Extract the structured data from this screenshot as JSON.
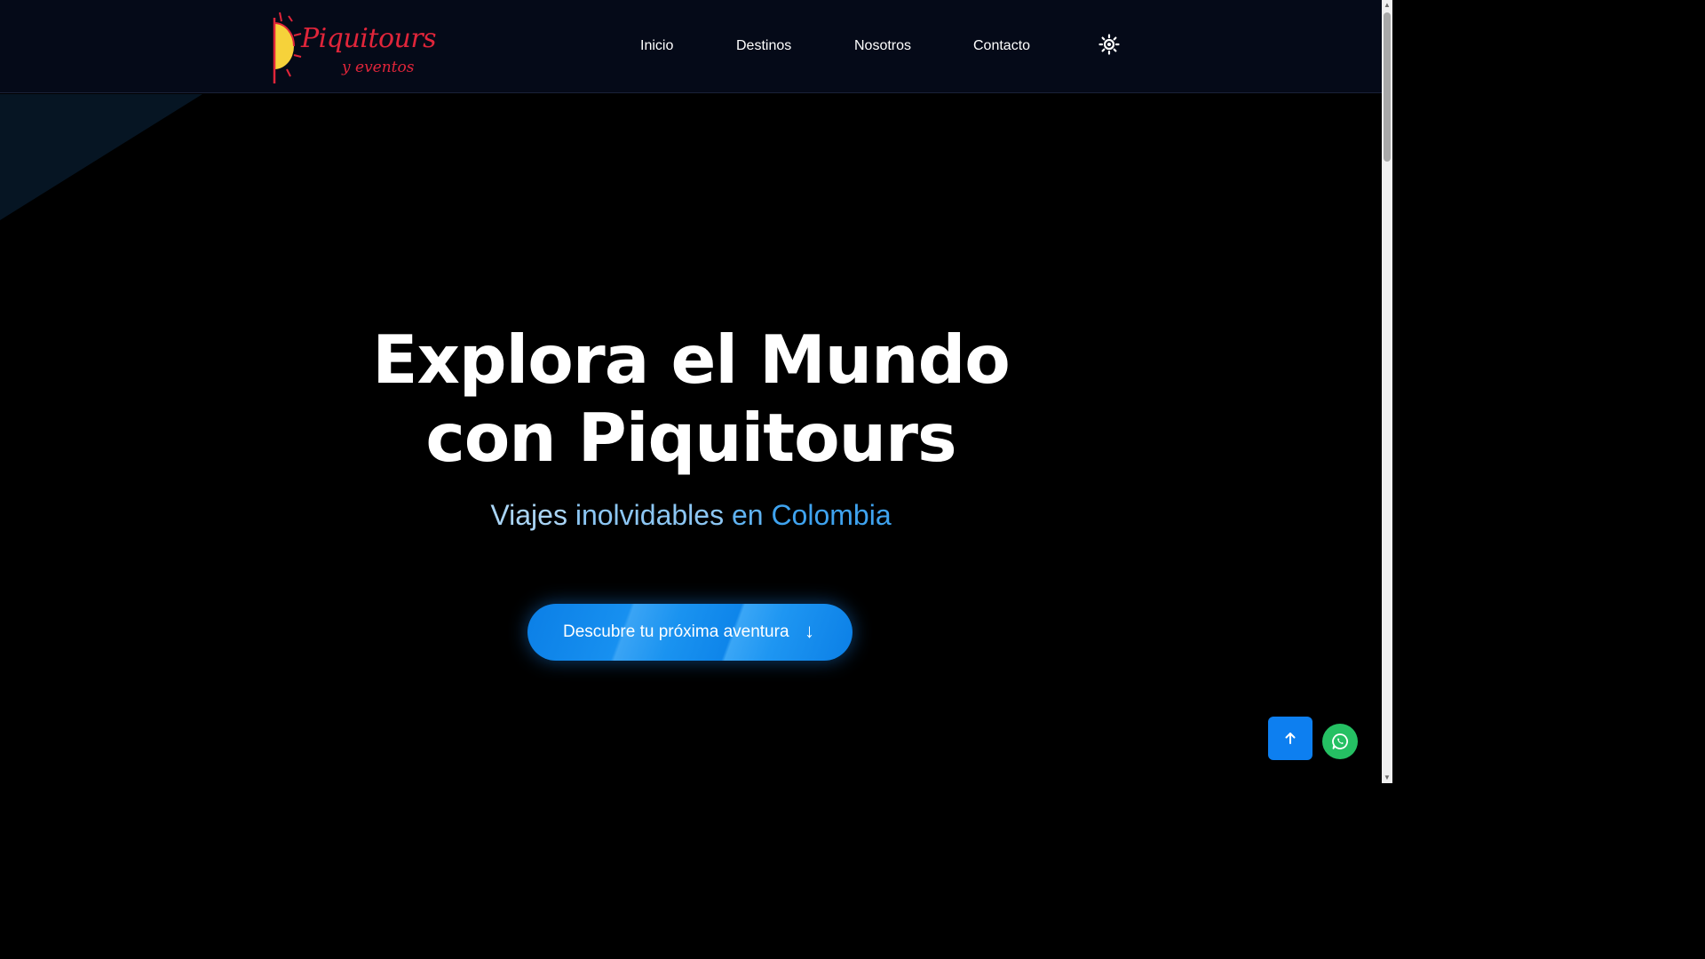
{
  "brand": {
    "logo_main": "Piquitours",
    "logo_sub": "y eventos",
    "colors": {
      "logo_red": "#e0253a",
      "sun_yellow": "#f6d23a",
      "accent_blue": "#0d7ff0",
      "whatsapp_green": "#25c063",
      "navbar_bg": "#050a18"
    }
  },
  "nav": {
    "items": [
      {
        "label": "Inicio"
      },
      {
        "label": "Destinos"
      },
      {
        "label": "Nosotros"
      },
      {
        "label": "Contacto"
      }
    ],
    "theme_toggle_icon": "sun-icon"
  },
  "hero": {
    "title_line1": "Explora el Mundo",
    "title_line2": "con Piquitours",
    "subtitle": {
      "part1": "Viajes",
      "part2": "inolvidables",
      "part3": "en",
      "part4": "Colombia"
    },
    "cta_label": "Descubre tu próxima aventura",
    "cta_arrow": "↓"
  },
  "floating": {
    "back_to_top_icon": "arrow-up-icon",
    "whatsapp_icon": "whatsapp-icon"
  }
}
